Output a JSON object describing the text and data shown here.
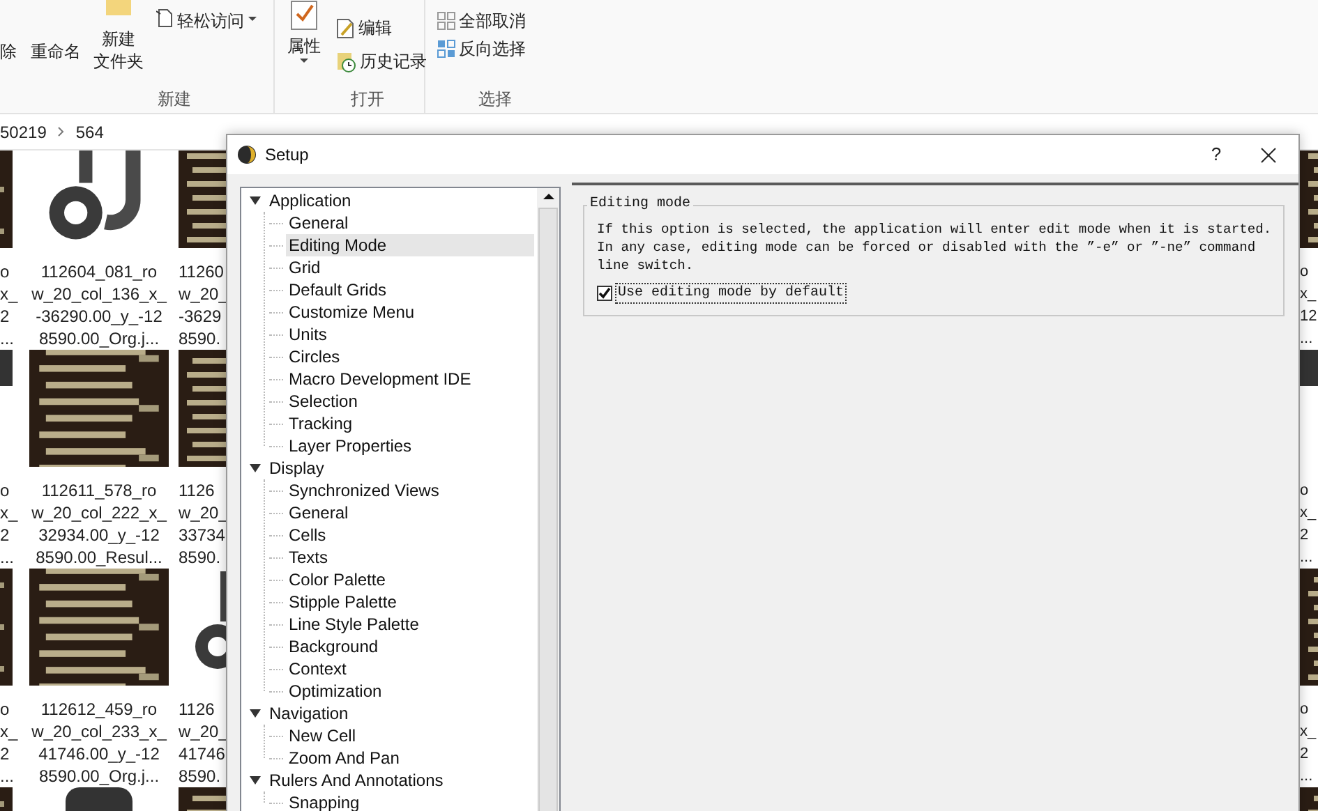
{
  "ribbon": {
    "groups": [
      {
        "items": [
          {
            "kind": "delete",
            "label": "除"
          },
          {
            "kind": "rename",
            "label": "重命名"
          }
        ]
      },
      {
        "label": "新建",
        "items": [
          {
            "kind": "newfolder",
            "lines": [
              "新建",
              "文件夹"
            ]
          },
          {
            "kind": "access",
            "label": "轻松访问"
          }
        ]
      },
      {
        "label": "打开",
        "items": [
          {
            "kind": "properties",
            "label": "属性"
          },
          {
            "kind": "edit",
            "label": "编辑"
          },
          {
            "kind": "history",
            "label": "历史记录"
          }
        ]
      },
      {
        "label": "选择",
        "items": [
          {
            "kind": "selectnone",
            "label": "全部取消"
          },
          {
            "kind": "invert",
            "label": "反向选择"
          }
        ]
      }
    ]
  },
  "address": {
    "path": [
      "50219",
      "564"
    ]
  },
  "files": {
    "columns": [
      {
        "tiles": [
          {
            "kind": "picture",
            "lines": [
              "o",
              "x_",
              "2",
              "..."
            ]
          },
          {
            "kind": "picture",
            "lines": [
              "o",
              "x_",
              "2",
              "..."
            ]
          },
          {
            "kind": "picture",
            "lines": [
              "o",
              "x_",
              "2",
              "..."
            ]
          },
          {
            "kind": "picture"
          }
        ]
      },
      {
        "tiles": [
          {
            "kind": "picture",
            "lines": [
              "112604_081_ro",
              "w_20_col_136_x_",
              "-36290.00_y_-12",
              "8590.00_Org.j..."
            ]
          },
          {
            "kind": "picture",
            "lines": [
              "112611_578_ro",
              "w_20_col_222_x_",
              "32934.00_y_-12",
              "8590.00_Resul..."
            ]
          },
          {
            "kind": "picture",
            "lines": [
              "112612_459_ro",
              "w_20_col_233_x_",
              "41746.00_y_-12",
              "8590.00_Org.j..."
            ]
          },
          {
            "kind": "picture"
          }
        ]
      },
      {
        "tiles": [
          {
            "kind": "picture",
            "lines": [
              "11260",
              "w_20_",
              "-3629",
              "8590."
            ]
          },
          {
            "kind": "picture",
            "lines": [
              "1126",
              "w_20_",
              "33734",
              "8590."
            ]
          },
          {
            "kind": "picture",
            "lines": [
              "1126",
              "w_20_",
              "41746",
              "8590."
            ]
          },
          {
            "kind": "picture"
          }
        ]
      },
      {
        "tiles": [
          {
            "kind": "picture",
            "lines": [
              "o",
              "x_",
              "12",
              "..."
            ]
          },
          {
            "kind": "picture",
            "lines": [
              "o",
              "x_",
              "2",
              "..."
            ]
          },
          {
            "kind": "picture",
            "lines": [
              "o",
              "x_",
              "2",
              "..."
            ]
          },
          {
            "kind": "picture"
          }
        ]
      }
    ]
  },
  "dialog": {
    "title": "Setup",
    "help": "?",
    "tree": [
      {
        "label": "Application",
        "expanded": true,
        "selected": false,
        "children": [
          {
            "label": "General",
            "selected": false
          },
          {
            "label": "Editing Mode",
            "selected": true
          },
          {
            "label": "Grid",
            "selected": false
          },
          {
            "label": "Default Grids",
            "selected": false
          },
          {
            "label": "Customize Menu",
            "selected": false
          },
          {
            "label": "Units",
            "selected": false
          },
          {
            "label": "Circles",
            "selected": false
          },
          {
            "label": "Macro Development IDE",
            "selected": false
          },
          {
            "label": "Selection",
            "selected": false
          },
          {
            "label": "Tracking",
            "selected": false
          },
          {
            "label": "Layer Properties",
            "selected": false
          }
        ]
      },
      {
        "label": "Display",
        "expanded": true,
        "selected": false,
        "children": [
          {
            "label": "Synchronized Views",
            "selected": false
          },
          {
            "label": "General",
            "selected": false
          },
          {
            "label": "Cells",
            "selected": false
          },
          {
            "label": "Texts",
            "selected": false
          },
          {
            "label": "Color Palette",
            "selected": false
          },
          {
            "label": "Stipple Palette",
            "selected": false
          },
          {
            "label": "Line Style Palette",
            "selected": false
          },
          {
            "label": "Background",
            "selected": false
          },
          {
            "label": "Context",
            "selected": false
          },
          {
            "label": "Optimization",
            "selected": false
          }
        ]
      },
      {
        "label": "Navigation",
        "expanded": true,
        "selected": false,
        "children": [
          {
            "label": "New Cell",
            "selected": false
          },
          {
            "label": "Zoom And Pan",
            "selected": false
          }
        ]
      },
      {
        "label": "Rulers And Annotations",
        "expanded": true,
        "selected": false,
        "children": [
          {
            "label": "Snapping",
            "selected": false
          }
        ]
      }
    ],
    "options": {
      "group_title": "Editing mode",
      "description": "If this option is selected, the application will enter edit mode when it is started. In any case, editing mode can be forced or disabled with the ”-e” or ”-ne” command line switch.",
      "checkbox": {
        "label": "Use editing mode by default",
        "checked": true,
        "focused": true
      }
    }
  }
}
